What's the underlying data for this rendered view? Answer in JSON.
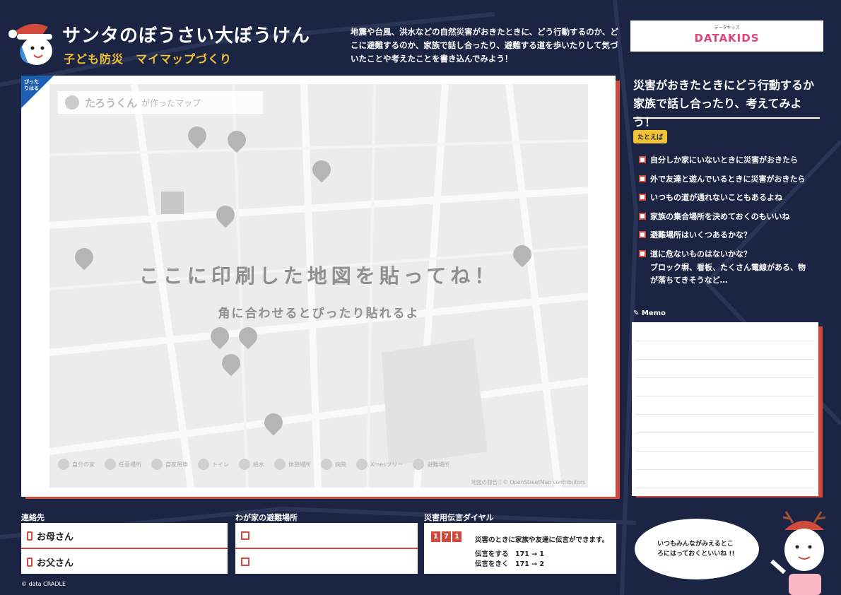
{
  "header": {
    "title": "サンタのぼうさい大ぼうけん",
    "subtitle": "子ども防災　マイマップづくり",
    "intro": "地震や台風、洪水などの自然災害がおきたときに、どう行動するのか、どこに避難するのか、家族で話し合ったり、避難する道を歩いたりして気づいたことや考えたことを書き込んでみよう！",
    "brand_kana": "データキッズ",
    "brand": "DATAKIDS"
  },
  "map": {
    "corner_tag": "ぴったりはる",
    "title_name": "たろうくん",
    "title_suffix": "が作ったマップ",
    "headline": "ここに印刷した地図を貼ってね！",
    "subline": "角に合わせるとぴったり貼れるよ",
    "legend": [
      "自分の家",
      "任意場所",
      "自家用車",
      "トイレ",
      "給水",
      "休憩場所",
      "病院",
      "Xmasツリー",
      "避難場所"
    ],
    "credit": "地図の報告 | © OpenStreetMap contributors"
  },
  "right": {
    "heading": "災害がおきたときにどう行動するか家族で話し合ったり、考えてみよう！",
    "example_label": "たとえば",
    "checklist": [
      "自分しか家にいないときに災害がおきたら",
      "外で友達と遊んでいるときに災害がおきたら",
      "いつもの道が通れないこともあるよね",
      "家族の集合場所を決めておくのもいいね",
      "避難場所はいくつあるかな？",
      "道に危ないものはないかな？"
    ],
    "check_extra": "ブロック塀、看板、たくさん電線がある、物が落ちてきそうなど…",
    "memo_label": "Memo"
  },
  "contacts": {
    "title": "連絡先",
    "mother": "お母さん",
    "father": "お父さん"
  },
  "shelter": {
    "title": "わが家の避難場所"
  },
  "dial": {
    "title": "災害用伝言ダイヤル",
    "digits": [
      "1",
      "7",
      "1"
    ],
    "desc": "災害のときに家族や友達に伝言ができます。",
    "record": "伝言をする　171 → 1",
    "play": "伝言をきく　171 → 2"
  },
  "bubble": "いつもみんながみえるところにはっておくといいね !!",
  "copyright": "© data CRADLE"
}
